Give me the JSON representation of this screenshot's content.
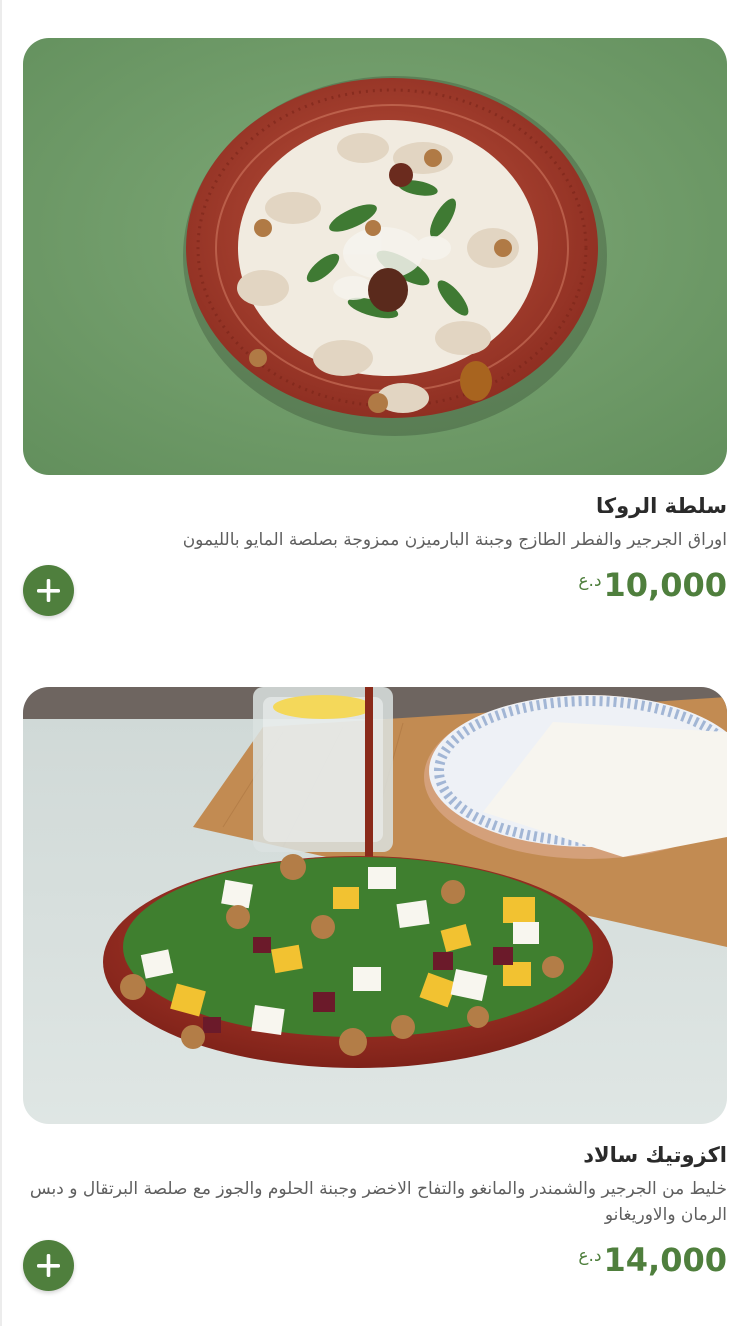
{
  "colors": {
    "accent": "#4f7f3d",
    "title_text": "#2a2a2a",
    "description_text": "#5f5f5f",
    "photo1_background": "#739e6a",
    "bowl_red": "#a33a2a"
  },
  "items": [
    {
      "name": "سلطة الروكا",
      "description": "اوراق الجرجير والفطر الطازج وجبنة البارميزن ممزوجة بصلصة المايو بالليمون",
      "currency": "د.ع",
      "price": "10,000",
      "add_icon": "plus-icon",
      "photo_subject": "arugula mushroom salad bowl"
    },
    {
      "name": "اكزوتيك سالاد",
      "description": "خليط من الجرجير والشمندر والمانغو والتفاح الاخضر وجبنة الحلوم والجوز مع صلصة البرتقال و دبس الرمان والاوريغانو",
      "currency": "د.ع",
      "price": "14,000",
      "add_icon": "plus-icon",
      "photo_subject": "exotic salad bowl with dressing"
    }
  ]
}
